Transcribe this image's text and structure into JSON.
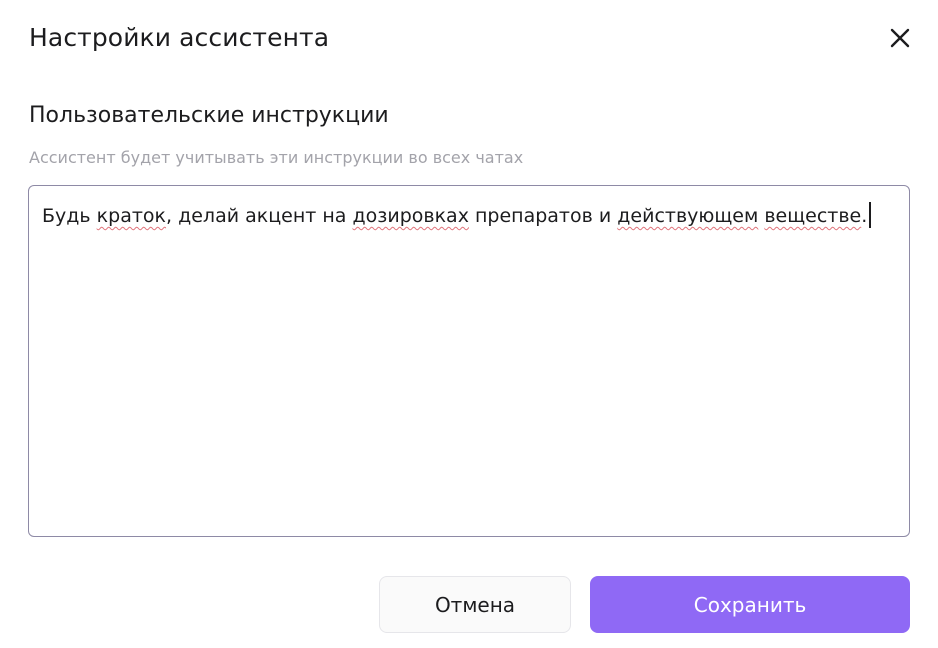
{
  "dialog": {
    "title": "Настройки ассистента",
    "close_icon": "close-icon"
  },
  "instructions": {
    "section_title": "Пользовательские инструкции",
    "hint": "Ассистент будет учитывать эти инструкции во всех чатах",
    "value_segments": [
      "Будь ",
      "краток",
      ", делай акцент на ",
      "дозировках",
      " препаратов и ",
      "действующем",
      " ",
      "веществе",
      "."
    ]
  },
  "buttons": {
    "cancel_label": "Отмена",
    "save_label": "Сохранить"
  },
  "colors": {
    "accent": "#8f69f5",
    "text": "#1c1c1e",
    "hint": "#a3a3aa",
    "field_border": "#8e8aa6",
    "spellcheck": "#e0737a"
  }
}
